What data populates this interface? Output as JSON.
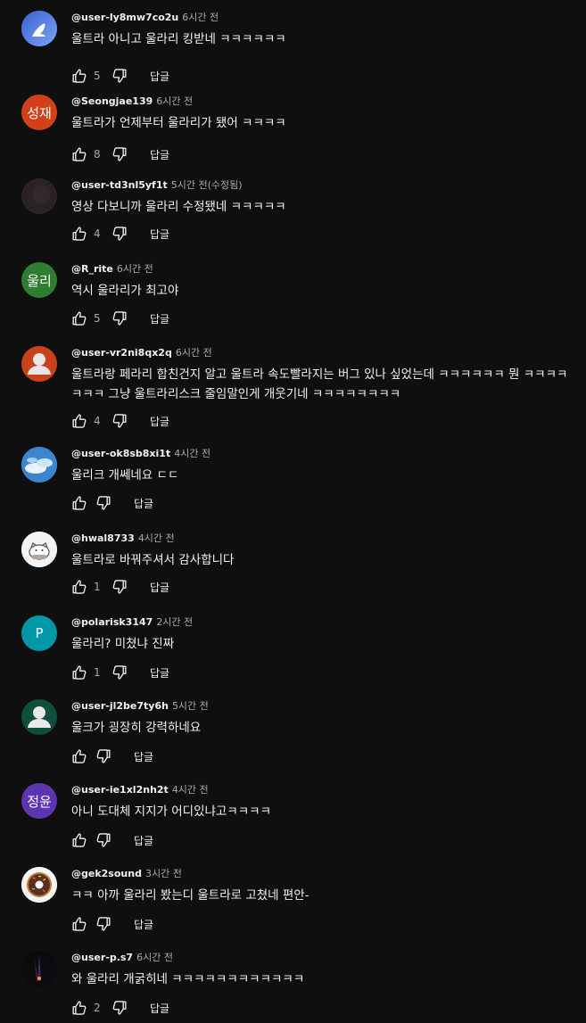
{
  "comments": [
    {
      "handle": "@user-ly8mw7co2u",
      "time": "6시간 전",
      "text": "울트라 아니고 울라리 킹받네 ㅋㅋㅋㅋㅋㅋ",
      "likes": "5",
      "reply": "답글",
      "avatar": {
        "type": "image",
        "icon": "bird-avatar-icon",
        "color": "#4a74d8"
      }
    },
    {
      "handle": "@Seongjae139",
      "time": "6시간 전",
      "text": "울트라가 언제부터 울라리가 됐어 ㅋㅋㅋㅋ",
      "likes": "8",
      "reply": "답글",
      "avatar": {
        "type": "initial",
        "label": "성재",
        "color": "#d2401a"
      }
    },
    {
      "handle": "@user-td3nl5yf1t",
      "time": "5시간 전(수정됨)",
      "text": "영상 다보니까 울라리 수정됐네 ㅋㅋㅋㅋㅋ",
      "likes": "4",
      "reply": "답글",
      "avatar": {
        "type": "image",
        "icon": "dark-avatar-icon",
        "color": "#2a2224"
      }
    },
    {
      "handle": "@R_rite",
      "time": "6시간 전",
      "text": "역시 울라리가 최고야",
      "likes": "5",
      "reply": "답글",
      "avatar": {
        "type": "initial",
        "label": "울리",
        "color": "#2e7d32"
      }
    },
    {
      "handle": "@user-vr2ni8qx2q",
      "time": "6시간 전",
      "text": "울트라랑 페라리 합친건지 알고 울트라 속도빨라지는 버그 있나 싶었는데 ㅋㅋㅋㅋㅋㅋ 뭔 ㅋㅋㅋㅋㅋㅋㅋ 그냥 울트라리스크 줄임말인게 개웃기네 ㅋㅋㅋㅋㅋㅋㅋㅋ",
      "likes": "4",
      "reply": "답글",
      "avatar": {
        "type": "default",
        "icon": "person-avatar-icon",
        "color": "#c8431c"
      }
    },
    {
      "handle": "@user-ok8sb8xi1t",
      "time": "4시간 전",
      "text": "울리크 개쎄네요 ㄷㄷ",
      "likes": "",
      "reply": "답글",
      "avatar": {
        "type": "image",
        "icon": "sky-avatar-icon",
        "color": "#4b8fd0"
      }
    },
    {
      "handle": "@hwal8733",
      "time": "4시간 전",
      "text": "울트라로 바꿔주셔서 감사합니다",
      "likes": "1",
      "reply": "답글",
      "avatar": {
        "type": "image",
        "icon": "cat-avatar-icon",
        "color": "#f2f2f2"
      }
    },
    {
      "handle": "@polarisk3147",
      "time": "2시간 전",
      "text": "울라리? 미쳤냐 진짜",
      "likes": "1",
      "reply": "답글",
      "avatar": {
        "type": "initial",
        "label": "P",
        "color": "#0097a7"
      }
    },
    {
      "handle": "@user-jl2be7ty6h",
      "time": "5시간 전",
      "text": "울크가 굉장히 강력하네요",
      "likes": "",
      "reply": "답글",
      "avatar": {
        "type": "default",
        "icon": "person-avatar-icon",
        "color": "#0f4d3c"
      }
    },
    {
      "handle": "@user-ie1xl2nh2t",
      "time": "4시간 전",
      "text": "아니 도대체 지지가 어디있냐고ㅋㅋㅋㅋ",
      "likes": "",
      "reply": "답글",
      "avatar": {
        "type": "initial",
        "label": "정윤",
        "color": "#5e35b1"
      }
    },
    {
      "handle": "@gek2sound",
      "time": "3시간 전",
      "text": "ㅋㅋ 아까 울라리 봤는디 울트라로 고쳤네 편안-",
      "likes": "",
      "reply": "답글",
      "avatar": {
        "type": "image",
        "icon": "donut-avatar-icon",
        "color": "#f2f2f2"
      }
    },
    {
      "handle": "@user-p.s7",
      "time": "6시간 전",
      "text": "와 울라리 개굵히네 ㅋㅋㅋㅋㅋㅋㅋㅋㅋㅋㅋㅋ",
      "likes": "2",
      "reply": "답글",
      "avatar": {
        "type": "image",
        "icon": "dark-light-avatar-icon",
        "color": "#111111"
      }
    }
  ]
}
